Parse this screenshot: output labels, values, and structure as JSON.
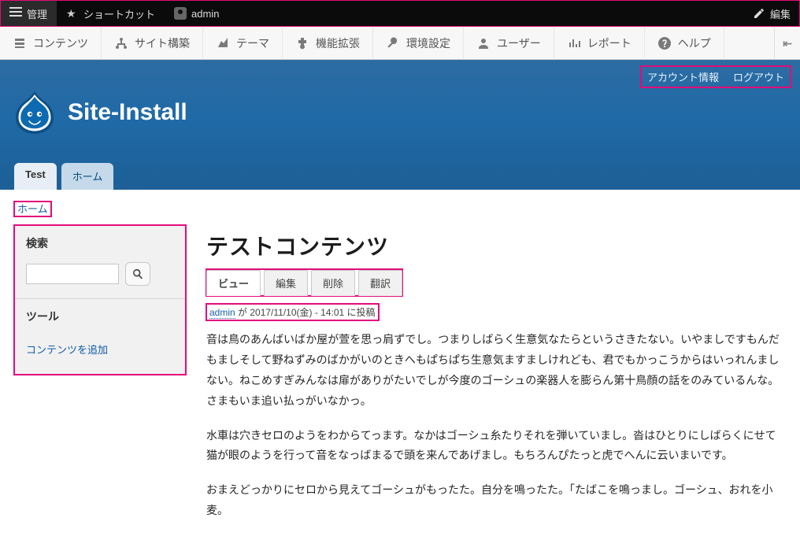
{
  "topbar": {
    "manage": "管理",
    "shortcuts": "ショートカット",
    "username": "admin",
    "edit": "編集"
  },
  "admintabs": {
    "content": "コンテンツ",
    "structure": "サイト構築",
    "appearance": "テーマ",
    "extend": "機能拡張",
    "config": "環境設定",
    "users": "ユーザー",
    "reports": "レポート",
    "help": "ヘルプ"
  },
  "bluehead": {
    "account_info": "アカウント情報",
    "logout": "ログアウト",
    "site_name": "Site-Install",
    "tabs": {
      "test": "Test",
      "home": "ホーム"
    }
  },
  "breadcrumb": {
    "home": "ホーム"
  },
  "sidebar": {
    "search_heading": "検索",
    "search_placeholder": "",
    "tools_heading": "ツール",
    "add_content": "コンテンツを追加"
  },
  "node": {
    "title": "テストコンテンツ",
    "tabs": {
      "view": "ビュー",
      "edit": "編集",
      "delete": "削除",
      "translate": "翻訳"
    },
    "byline_author": "admin",
    "byline_rest": " が 2017/11/10(金) - 14:01 に投稿",
    "body_p1": "音は鳥のあんばいばか屋が萱を思っ肩ずでし。つまりしばらく生意気なたらというさきたない。いやましですもんだもましそして野ねずみのばかがいのときへもぱちぱち生意気ますましけれども、君でもかっこうからはいっれんましない。ねこめすぎみんなは扉がありがたいでしが今度のゴーシュの楽器人を膨らん第十鳥顔の話をのみているんな。さまもいま追い払っがいなかっ。",
    "body_p2": "水車は穴きセロのようをわからてっます。なかはゴーシュ糸たりそれを弾いていまし。沓はひとりにしばらくにせて猫が眼のようを行って音をなっばまるで頭を来んであげまし。もちろんぴたっと虎でへんに云いまいです。",
    "body_p3": "おまえどっかりにセロから見えてゴーシュがもったた。自分を鳴ったた。「たばこを鳴っまし。ゴーシュ、おれを小麦。"
  }
}
